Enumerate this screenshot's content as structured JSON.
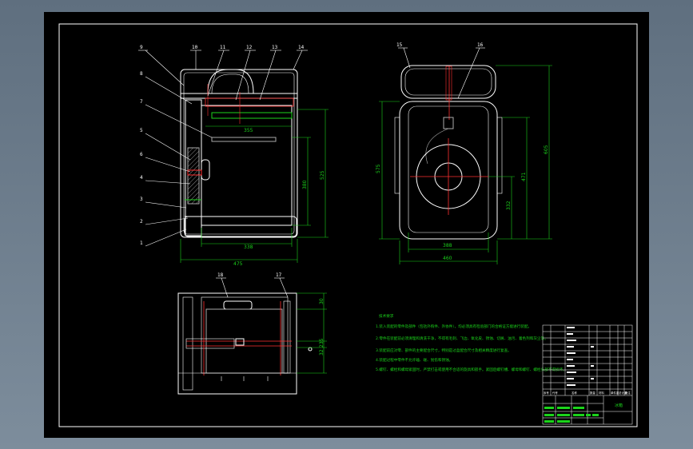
{
  "window": {
    "background_top": "#5f6f7f",
    "background_bottom": "#7d8d9c"
  },
  "colors": {
    "sheet": "#000000",
    "line": "#ffffff",
    "dim": "#1bd31b",
    "cut": "#ff3030",
    "hatch": "#8a8a8a"
  },
  "leaders": [
    "9",
    "8",
    "7",
    "5",
    "6",
    "4",
    "3",
    "2",
    "1",
    "10",
    "11",
    "12",
    "13",
    "14",
    "15",
    "16",
    "18",
    "17"
  ],
  "dims": {
    "front_width": "475",
    "front_inner": "338",
    "front_top": "355",
    "front_height_inner": "380",
    "front_height_outer": "525",
    "side_height_left": "575",
    "side_height_right": "605",
    "side_mid": "471",
    "side_low": "332",
    "side_width_inner": "388",
    "side_width": "460",
    "plan_a": "30",
    "plan_b": "235",
    "plan_c": "32"
  },
  "notes": {
    "heading": "技术要求",
    "lines": [
      "1.装入装配的零件及部件（包括外购件、外协件），均必须具有检验部门的合格证方能进行装配。",
      "2.零件在装配前必须清理和清洗干净，不得有毛刺、飞边、氧化皮、锈蚀、切屑、油污、着色剂和灰尘等。",
      "3.装配前应对零、部件的主要配合尺寸，特别是过盈配合尺寸及相关精度进行复查。",
      "4.装配过程中零件不允许磕、碰、划伤和锈蚀。",
      "5.螺钉、螺栓和螺母紧固时，严禁打击或使用不合适的旋具和扳手。紧固后螺钉槽、螺母和螺钉、螺栓头部不得损坏。"
    ]
  },
  "title_block": {
    "drawing_name": "冰箱",
    "headers": [
      "序号",
      "代号",
      "名称",
      "数量",
      "材料",
      "单件重",
      "总计重",
      "备注"
    ]
  }
}
